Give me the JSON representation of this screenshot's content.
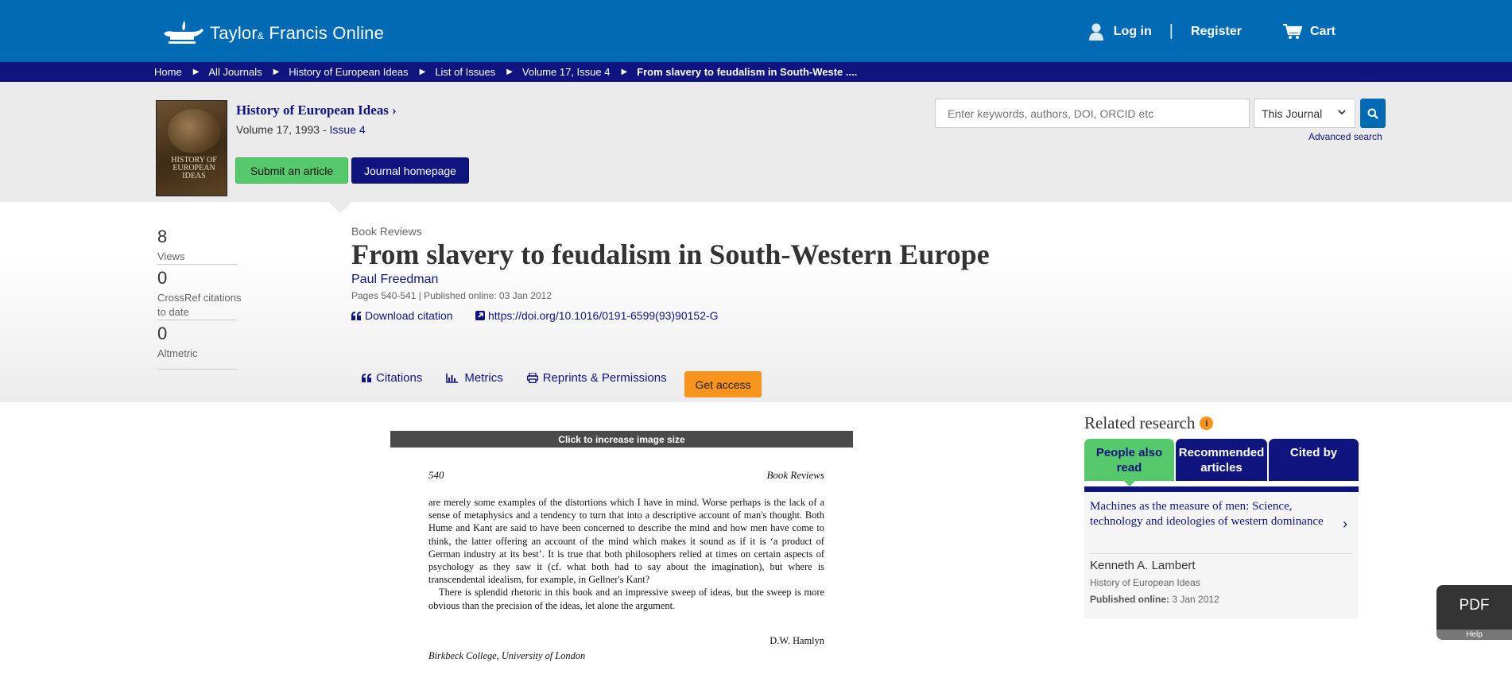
{
  "header": {
    "logo_text": "Taylor",
    "logo_amp": "&",
    "logo_text2": "Francis Online",
    "login": "Log in",
    "separator": "|",
    "register": "Register",
    "cart": "Cart"
  },
  "breadcrumb": [
    "Home",
    "All Journals",
    "History of European Ideas",
    "List of Issues",
    "Volume 17, Issue 4",
    "From slavery to feudalism in South-Weste ...."
  ],
  "journal": {
    "title": "History of European Ideas",
    "title_chevron": "›",
    "volume": "Volume 17, 1993 - ",
    "issue_link": "Issue 4",
    "cover_text": "HISTORY OF EUROPEAN IDEAS",
    "submit_label": "Submit an article",
    "homepage_label": "Journal homepage"
  },
  "search": {
    "placeholder": "Enter keywords, authors, DOI, ORCID etc",
    "scope": "This Journal",
    "advanced": "Advanced search"
  },
  "metrics": [
    {
      "value": "8",
      "label": "Views"
    },
    {
      "value": "0",
      "label": "CrossRef citations to date"
    },
    {
      "value": "0",
      "label": "Altmetric"
    }
  ],
  "article": {
    "section": "Book Reviews",
    "title": "From slavery to feudalism in South-Western Europe",
    "author": "Paul Freedman",
    "pages": "Pages 540-541 | Published online: 03 Jan 2012",
    "download_citation": "Download citation",
    "doi": "https://doi.org/10.1016/0191-6599(93)90152-G"
  },
  "tabs": {
    "citations": "Citations",
    "metrics": "Metrics",
    "reprints": "Reprints & Permissions",
    "get_access": "Get access"
  },
  "preview": {
    "bar": "Click to increase image size",
    "page_number": "540",
    "running_head": "Book Reviews",
    "body": "are merely some examples of the distortions which I have in mind. Worse perhaps is the lack of a sense of metaphysics and a tendency to turn that into a descriptive account of man's thought. Both Hume and Kant are said to have been concerned to describe the mind and how men have come to think, the latter offering an account of the mind which makes it sound as if it is ‘a product of German industry at its best’. It is true that both philosophers relied at times on certain aspects of psychology as they saw it (cf. what both had to say about the imagination), but where is transcendental idealism, for example, in Gellner's Kant?",
    "body2": "There is splendid rhetoric in this book and an impressive sweep of ideas, but the sweep is more obvious than the precision of the ideas, let alone the argument.",
    "signature": "D.W. Hamlyn",
    "affiliation": "Birkbeck College, University of London"
  },
  "related": {
    "heading": "Related research",
    "info": "i",
    "tabs": [
      "People also read",
      "Recommended articles",
      "Cited by"
    ],
    "item": {
      "title": "Machines as the measure of men: Science, technology and ideologies of western dominance",
      "chevron": "›",
      "author": "Kenneth A. Lambert",
      "journal": "History of European Ideas",
      "published_label": "Published online:",
      "published_date": " 3 Jan 2012"
    }
  },
  "pdf_widget": {
    "label": "PDF",
    "help": "Help"
  },
  "colors": {
    "brand_blue": "#006bb4",
    "navy": "#10147e",
    "green": "#55c96b",
    "orange": "#f7941d"
  }
}
